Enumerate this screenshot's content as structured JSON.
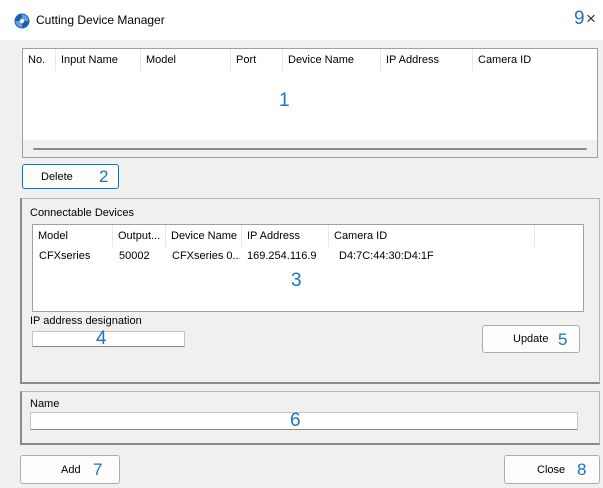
{
  "window": {
    "title": "Cutting Device Manager",
    "close_glyph": "×",
    "icon": "app-logo-icon"
  },
  "annotations": {
    "n1": "1",
    "n2": "2",
    "n3": "3",
    "n4": "4",
    "n5": "5",
    "n6": "6",
    "n7": "7",
    "n8": "8",
    "n9": "9"
  },
  "device_list": {
    "columns": [
      "No.",
      "Input Name",
      "Model",
      "Port",
      "Device Name",
      "IP Address",
      "Camera ID"
    ],
    "rows": []
  },
  "buttons": {
    "delete": "Delete",
    "update": "Update",
    "add": "Add",
    "close": "Close"
  },
  "connectable": {
    "label": "Connectable Devices",
    "columns": [
      "Model",
      "Output...",
      "Device Name",
      "IP Address",
      "Camera ID"
    ],
    "rows": [
      {
        "model": "CFXseries",
        "output": "50002",
        "device_name": "CFXseries 0...",
        "ip": "169.254.116.9",
        "camera_id": "D4:7C:44:30:D4:1F"
      }
    ],
    "ip_label": "IP address designation",
    "ip_value": ""
  },
  "name_section": {
    "label": "Name",
    "value": ""
  }
}
